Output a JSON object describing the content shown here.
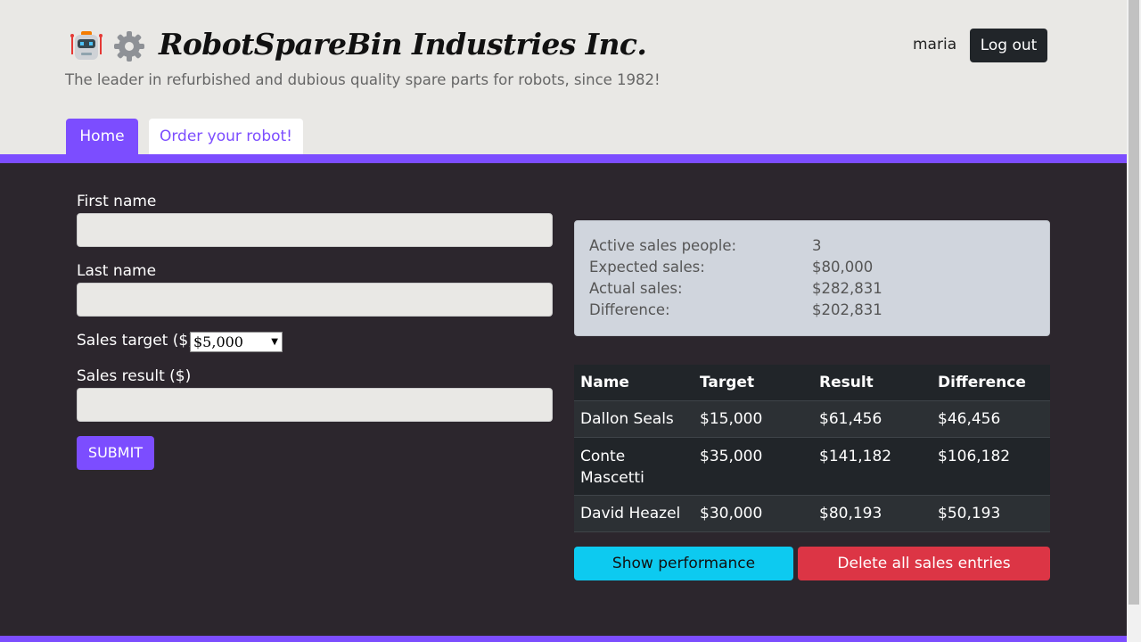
{
  "header": {
    "brand": "RobotSpareBin Industries Inc.",
    "tagline": "The leader in refurbished and dubious quality spare parts for robots, since 1982!",
    "username": "maria",
    "logout_label": "Log out",
    "logo_icons": [
      "robot-icon",
      "gear-icon"
    ]
  },
  "tabs": [
    {
      "label": "Home",
      "active": true
    },
    {
      "label": "Order your robot!",
      "active": false
    }
  ],
  "form": {
    "first_name_label": "First name",
    "first_name_value": "",
    "last_name_label": "Last name",
    "last_name_value": "",
    "sales_target_label": "Sales target ($)",
    "sales_target_value": "$5,000",
    "sales_result_label": "Sales result ($)",
    "sales_result_value": "",
    "submit_label": "SUBMIT"
  },
  "summary": [
    {
      "label": "Active sales people:",
      "value": "3"
    },
    {
      "label": "Expected sales:",
      "value": "$80,000"
    },
    {
      "label": "Actual sales:",
      "value": "$282,831"
    },
    {
      "label": "Difference:",
      "value": "$202,831"
    }
  ],
  "table": {
    "headers": [
      "Name",
      "Target",
      "Result",
      "Difference"
    ],
    "rows": [
      [
        "Dallon Seals",
        "$15,000",
        "$61,456",
        "$46,456"
      ],
      [
        "Conte Mascetti",
        "$35,000",
        "$141,182",
        "$106,182"
      ],
      [
        "David Heazel",
        "$30,000",
        "$80,193",
        "$50,193"
      ]
    ]
  },
  "actions": {
    "show_performance_label": "Show performance",
    "delete_all_label": "Delete all sales entries"
  },
  "colors": {
    "accent": "#7c4dff",
    "dark_bg": "#2c262d",
    "info": "#0dcaf0",
    "danger": "#dc3545"
  }
}
